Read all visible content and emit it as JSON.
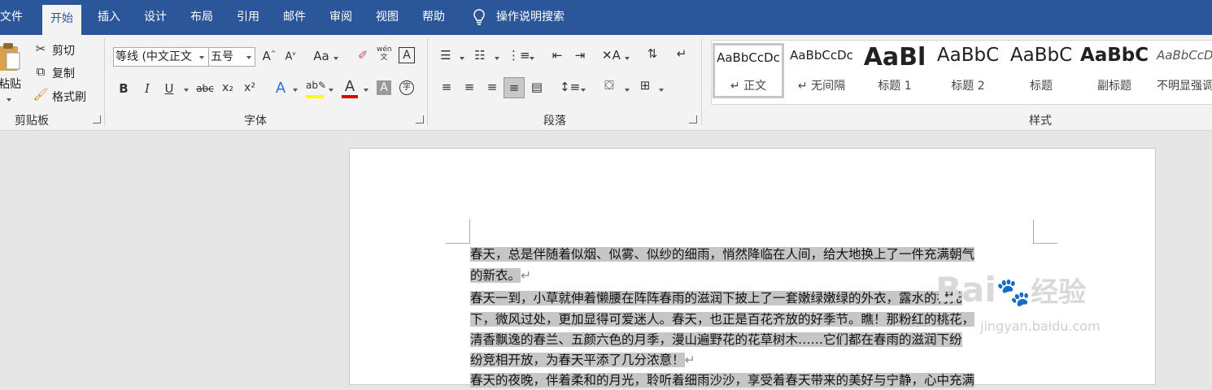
{
  "tabs": [
    {
      "label": "文件"
    },
    {
      "label": "开始"
    },
    {
      "label": "插入"
    },
    {
      "label": "设计"
    },
    {
      "label": "布局"
    },
    {
      "label": "引用"
    },
    {
      "label": "邮件"
    },
    {
      "label": "审阅"
    },
    {
      "label": "视图"
    },
    {
      "label": "帮助"
    }
  ],
  "tell_me": {
    "label": "操作说明搜索"
  },
  "clipboard": {
    "paste": "粘贴",
    "cut": "剪切",
    "copy": "复制",
    "format_painter": "格式刷",
    "group_label": "剪贴板"
  },
  "font": {
    "font_name": "等线 (中文正文",
    "font_size": "五号",
    "group_label": "字体",
    "change_case": "Aa",
    "phonetic": "wén\n文",
    "border": "A",
    "bold": "B",
    "italic": "I",
    "underline": "U",
    "strike": "abc",
    "subscript": "x₂",
    "superscript": "x²",
    "effects": "A",
    "highlight_color": "#ffff00",
    "font_color": "#e00000",
    "shading": "A",
    "enclose": "字"
  },
  "paragraph": {
    "group_label": "段落"
  },
  "styles": {
    "group_label": "样式",
    "items": [
      {
        "sample": "AaBbCcDc",
        "name": "↵ 正文"
      },
      {
        "sample": "AaBbCcDc",
        "name": "↵ 无间隔"
      },
      {
        "sample": "AaBl",
        "name": "标题 1"
      },
      {
        "sample": "AaBbC",
        "name": "标题 2"
      },
      {
        "sample": "AaBbC",
        "name": "标题"
      },
      {
        "sample": "AaBbC",
        "name": "副标题"
      },
      {
        "sample": "AaBbCcD",
        "name": "不明显强调"
      }
    ]
  },
  "document": {
    "lines": [
      {
        "text": "春天，总是伴随着似烟、似雾、似纱的细雨，悄然降临在人间，给大地换上了一件充满朝气",
        "mark": ""
      },
      {
        "text": "的新衣。",
        "mark": "↵"
      },
      {
        "text": "春天一到，小草就伸着懒腰在阵阵春雨的滋润下披上了一套嫩绿嫩绿的外衣，露水的衬托",
        "mark": ""
      },
      {
        "text": "下，微风过处，更加显得可爱迷人。春天，也正是百花齐放的好季节。瞧！那粉红的桃花，",
        "mark": ""
      },
      {
        "text": "清香飘逸的春兰、五颜六色的月季，漫山遍野花的花草树木……它们都在春雨的滋润下纷",
        "mark": ""
      },
      {
        "text": "纷竞相开放，为春天平添了几分浓意！",
        "mark": "↵"
      },
      {
        "text": "春天的夜晚，伴着柔和的月光，聆听着细雨沙沙，享受着春天带来的美好与宁静，心中充满",
        "mark": ""
      }
    ]
  },
  "watermark": {
    "brand": "Bai",
    "brand2": "经验",
    "url": "jingyan.baidu.com"
  }
}
